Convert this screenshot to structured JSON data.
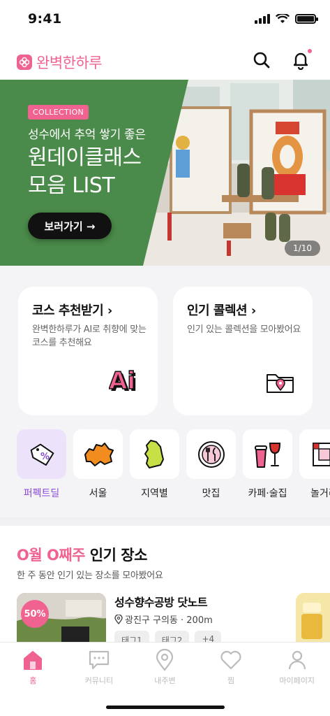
{
  "status_bar": {
    "time": "9:41"
  },
  "header": {
    "brand": "완벽한하루",
    "brand_color": "#f0628f"
  },
  "banner": {
    "tag": "COLLECTION",
    "subtitle": "성수에서 추억 쌓기 좋은",
    "title_line1": "원데이클래스",
    "title_line2": "모음 LIST",
    "button_label": "보러가기 →",
    "pager": "1/10",
    "panel_color": "#4a8a4a"
  },
  "cards": [
    {
      "title": "코스 추천받기 ›",
      "desc": "완벽한하루가 AI로 취향에 맞는 코스를 추천해요",
      "icon": "ai-icon",
      "icon_text": "Ai"
    },
    {
      "title": "인기 콜렉션 ›",
      "desc": "인기 있는 콜렉션을 모아봤어요",
      "icon": "folder-pin-icon"
    }
  ],
  "categories": [
    {
      "label": "퍼펙트딜",
      "icon": "price-tag-icon",
      "active": true
    },
    {
      "label": "서울",
      "icon": "seoul-map-icon"
    },
    {
      "label": "지역별",
      "icon": "korea-map-icon"
    },
    {
      "label": "맛집",
      "icon": "plate-cutlery-icon"
    },
    {
      "label": "카페·술집",
      "icon": "drink-icon"
    },
    {
      "label": "놀거리",
      "icon": "board-game-icon"
    }
  ],
  "section": {
    "title_highlight": "O월 O째주",
    "title_rest": " 인기 장소",
    "subtitle": "한 주 동안 인기 있는 장소를 모아봤어요"
  },
  "place": {
    "discount": "50%",
    "name": "성수향수공방 닷노트",
    "location": "광진구 구의동 · 200m",
    "tags": [
      "태그1",
      "태그2",
      "+4"
    ]
  },
  "tabbar": [
    {
      "label": "홈",
      "icon": "home-icon",
      "active": true
    },
    {
      "label": "커뮤니티",
      "icon": "chat-icon"
    },
    {
      "label": "내주변",
      "icon": "location-pin-icon"
    },
    {
      "label": "찜",
      "icon": "heart-icon"
    },
    {
      "label": "마이페이지",
      "icon": "person-icon"
    }
  ]
}
